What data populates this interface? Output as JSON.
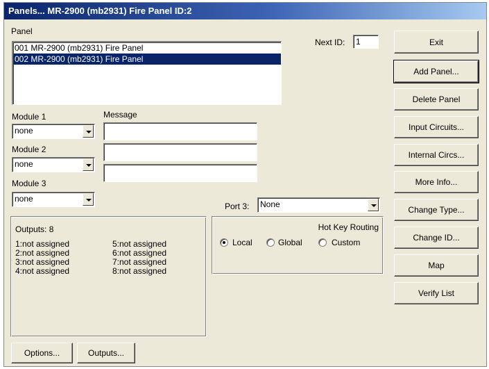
{
  "window": {
    "title": "Panels... MR-2900 (mb2931) Fire Panel ID:2"
  },
  "panel": {
    "label": "Panel",
    "items": [
      {
        "text": "001 MR-2900 (mb2931) Fire Panel",
        "selected": false
      },
      {
        "text": "002 MR-2900 (mb2931) Fire Panel",
        "selected": true
      }
    ]
  },
  "next_id": {
    "label": "Next ID:",
    "value": "1"
  },
  "modules": [
    {
      "label": "Module 1",
      "value": "none"
    },
    {
      "label": "Module 2",
      "value": "none"
    },
    {
      "label": "Module 3",
      "value": "none"
    }
  ],
  "message": {
    "label": "Message",
    "lines": [
      "",
      "",
      ""
    ]
  },
  "port3": {
    "label": "Port 3:",
    "value": "None"
  },
  "outputs": {
    "header": "Outputs: 8",
    "items": [
      "1:not assigned",
      "2:not assigned",
      "3:not assigned",
      "4:not assigned",
      "5:not assigned",
      "6:not assigned",
      "7:not assigned",
      "8:not assigned"
    ]
  },
  "hot_key_routing": {
    "title": "Hot Key Routing",
    "options": [
      {
        "label": "Local",
        "checked": true
      },
      {
        "label": "Global",
        "checked": false
      },
      {
        "label": "Custom",
        "checked": false
      }
    ]
  },
  "buttons": {
    "exit": "Exit",
    "add_panel": "Add Panel...",
    "delete_panel": "Delete Panel",
    "input_circuits": "Input Circuits...",
    "internal_circs": "Internal Circs...",
    "more_info": "More Info...",
    "change_type": "Change Type...",
    "change_id": "Change ID...",
    "map": "Map",
    "verify_list": "Verify List",
    "options": "Options...",
    "outputs": "Outputs..."
  }
}
